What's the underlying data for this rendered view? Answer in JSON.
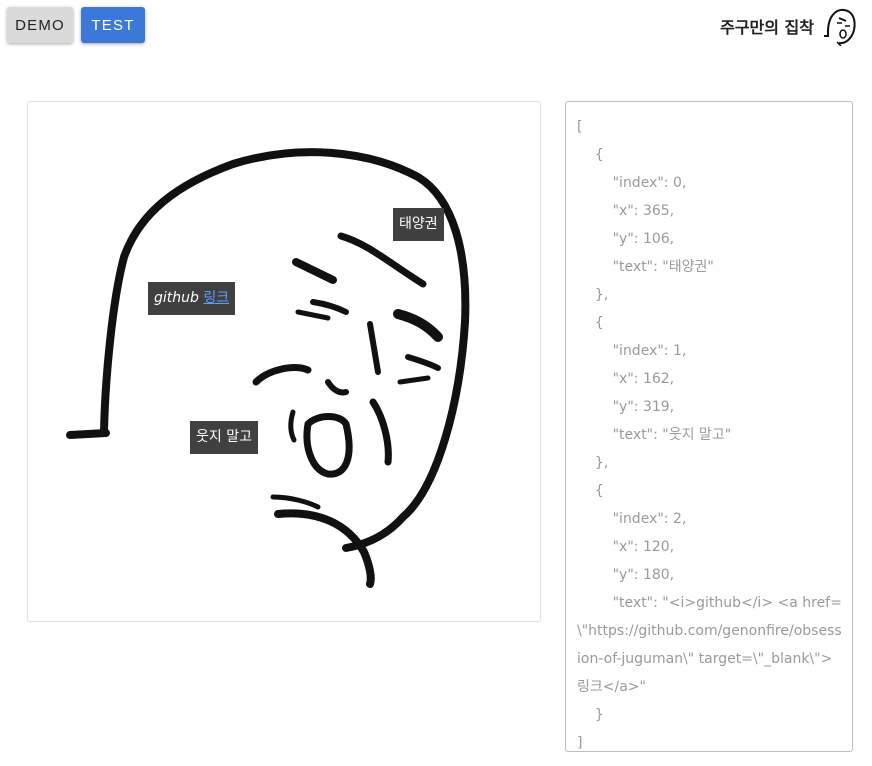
{
  "toolbar": {
    "demo_label": "DEMO",
    "test_label": "TEST",
    "demo_color": "#dadada",
    "test_color": "#3b78d8"
  },
  "brand": {
    "title": "주구만의 집착",
    "logo_icon": "face-sketch-icon"
  },
  "canvas": {
    "image": "meme-face-sketch",
    "tags": [
      {
        "index": 0,
        "text": "태양권"
      },
      {
        "index": 1,
        "text": "웃지 말고"
      },
      {
        "index": 2,
        "italic_text": "github",
        "link_text": "링크",
        "link_href": "https://github.com/genonfire/obsession-of-juguman"
      }
    ]
  },
  "json_view": {
    "text": "[\n    {\n        \"index\": 0,\n        \"x\": 365,\n        \"y\": 106,\n        \"text\": \"태양권\"\n    },\n    {\n        \"index\": 1,\n        \"x\": 162,\n        \"y\": 319,\n        \"text\": \"웃지 말고\"\n    },\n    {\n        \"index\": 2,\n        \"x\": 120,\n        \"y\": 180,\n        \"text\": \"<i>github</i> <a href=\\\"https://github.com/genonfire/obsession-of-juguman\\\" target=\\\"_blank\\\">링크</a>\"\n    }\n]"
  }
}
